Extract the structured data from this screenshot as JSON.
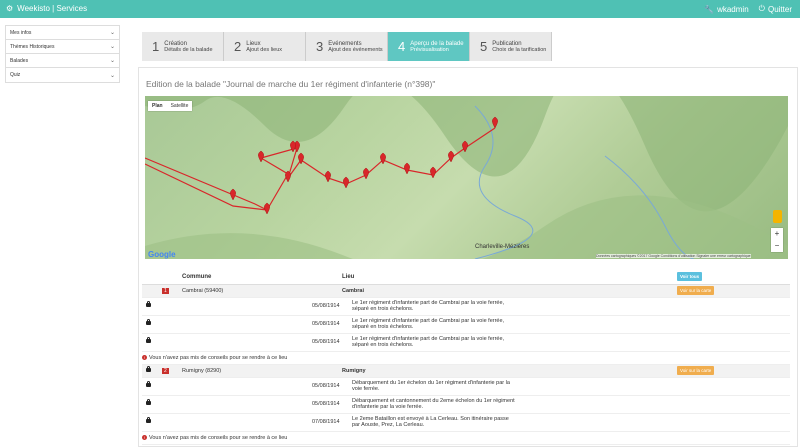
{
  "topbar": {
    "brand": "Weekisto | Services",
    "user": "wkadmin",
    "logout": "Quitter"
  },
  "sidebar": {
    "items": [
      {
        "label": "Mes infos"
      },
      {
        "label": "Thèmes Historiques"
      },
      {
        "label": "Balades"
      },
      {
        "label": "Quiz"
      }
    ]
  },
  "steps": [
    {
      "num": "1",
      "title": "Création",
      "sub": "Détails de la balade"
    },
    {
      "num": "2",
      "title": "Lieux",
      "sub": "Ajout des lieux"
    },
    {
      "num": "3",
      "title": "Evénements",
      "sub": "Ajout des événements"
    },
    {
      "num": "4",
      "title": "Aperçu de la balade",
      "sub": "Prévisualisation"
    },
    {
      "num": "5",
      "title": "Publication",
      "sub": "Choix de la tarification"
    }
  ],
  "page_title": "Edition de la balade \"Journal de marche du 1er régiment d'infanterie (n°398)\"",
  "map": {
    "tab_plan": "Plan",
    "tab_satellite": "Satellite",
    "google": "Google",
    "attribution": "Données cartographiques ©2017 Google   Conditions d'utilisation   Signaler une erreur cartographique",
    "zoom_in": "+",
    "zoom_out": "−",
    "city_label": "Charleville-Mézières"
  },
  "table": {
    "headers": {
      "commune": "Commune",
      "lieu": "Lieu",
      "all": "Voir tous"
    },
    "places": [
      {
        "index": "1",
        "commune": "Cambrai (59400)",
        "lieu": "Cambrai",
        "button": "Voir sur la carte",
        "events": [
          {
            "date": "05/08/1914",
            "text": "Le 1er régiment d'infanterie part de Cambrai par la voie ferrée, séparé en trois échelons."
          },
          {
            "date": "05/08/1914",
            "text": "Le 1er régiment d'infanterie part de Cambrai par la voie ferrée, séparé en trois échelons."
          },
          {
            "date": "05/08/1914",
            "text": "Le 1er régiment d'infanterie part de Cambrai par la voie ferrée, séparé en trois échelons."
          }
        ],
        "warning": "Vous n'avez pas mis de conseils pour se rendre à ce lieu"
      },
      {
        "index": "2",
        "commune": "Rumigny (8290)",
        "lieu": "Rumigny",
        "button": "Voir sur la carte",
        "events": [
          {
            "date": "05/08/1914",
            "text": "Débarquement du 1er échelon du 1er régiment d'infanterie par la voie ferrée."
          },
          {
            "date": "05/08/1914",
            "text": "Débarquement et cantonnement du 2eme échelon du 1er régiment d'infanterie par la voie ferrée."
          },
          {
            "date": "07/08/1914",
            "text": "Le 2eme Bataillon est envoyé à La Cerleau. Son itinéraire passe par Aouste, Prez, La Cerleau."
          }
        ],
        "warning": "Vous n'avez pas mis de conseils pour se rendre à ce lieu"
      }
    ]
  },
  "colors": {
    "accent": "#4fc1b4",
    "active_step": "#5fc7c2",
    "marker": "#d9262a",
    "route": "#d9262a"
  }
}
